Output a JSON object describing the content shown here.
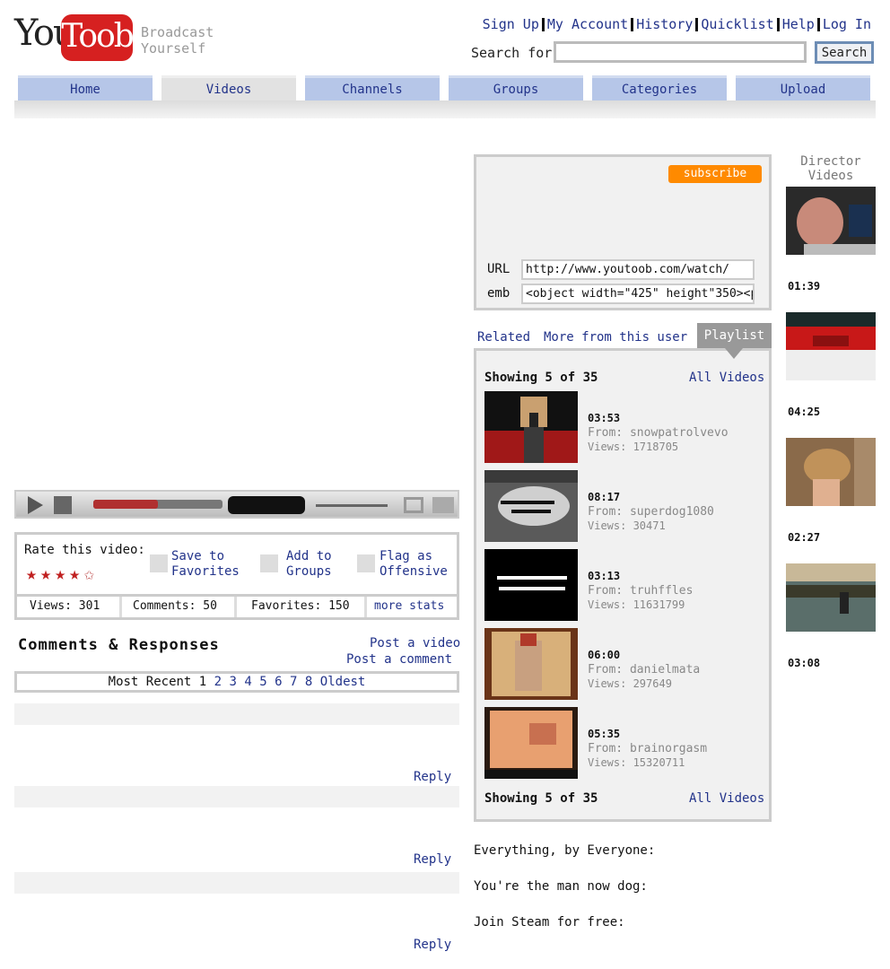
{
  "header": {
    "logo_left": "You",
    "logo_right": "Toob",
    "tagline_1": "Broadcast",
    "tagline_2": "Yourself",
    "links": [
      "Sign Up",
      "My Account",
      "History",
      "Quicklist",
      "Help",
      "Log In"
    ],
    "search_label": "Search for",
    "search_value": "",
    "search_button": "Search"
  },
  "nav": {
    "tabs": [
      "Home",
      "Videos",
      "Channels",
      "Groups",
      "Categories",
      "Upload"
    ],
    "active": "Videos"
  },
  "player": {
    "progress": 0.5
  },
  "rate": {
    "label": "Rate this video:",
    "rating": 4.5,
    "save_1": "Save to",
    "save_2": "Favorites",
    "groups_1": "Add to",
    "groups_2": "Groups",
    "flag_1": "Flag as",
    "flag_2": "Offensive"
  },
  "stats": {
    "views": "Views: 301",
    "comments": "Comments: 50",
    "favorites": "Favorites: 150",
    "more": "more stats"
  },
  "comments": {
    "title": "Comments & Responses",
    "post_video": "Post a video",
    "post_comment": "Post a comment",
    "pager_prefix": "Most Recent 1",
    "pages": [
      "2",
      "3",
      "4",
      "5",
      "6",
      "7",
      "8"
    ],
    "oldest": "Oldest",
    "reply": "Reply"
  },
  "info": {
    "subscribe": "subscribe",
    "url_label": "URL",
    "url_value": "http://www.youtoob.com/watch/",
    "emb_label": "emb",
    "emb_value": "<object width=\"425\" height\"350><p"
  },
  "related": {
    "tabs": [
      "Related",
      "More from this user"
    ],
    "playlist_tab": "Playlist",
    "showing": "Showing 5 of 35",
    "all_videos": "All Videos",
    "items": [
      {
        "duration": "03:53",
        "from": "From: snowpatrolvevo",
        "views": "Views: 1718705"
      },
      {
        "duration": "08:17",
        "from": "From: superdog1080",
        "views": "Views: 30471"
      },
      {
        "duration": "03:13",
        "from": "From: truhffles",
        "views": "Views: 11631799"
      },
      {
        "duration": "06:00",
        "from": "From: danielmata",
        "views": "Views: 297649"
      },
      {
        "duration": "05:35",
        "from": "From: brainorgasm",
        "views": "Views: 15320711"
      }
    ]
  },
  "bottom": {
    "line1": "Everything, by Everyone:",
    "line2": "You're the man now dog:",
    "line3": "Join Steam for free:"
  },
  "director": {
    "title_1": "Director",
    "title_2": "Videos",
    "durations": [
      "01:39",
      "04:25",
      "02:27",
      "03:08"
    ]
  }
}
